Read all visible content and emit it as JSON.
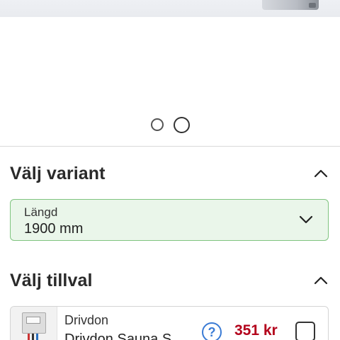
{
  "gallery": {
    "dots": [
      "",
      ""
    ],
    "active_index": 1
  },
  "variant": {
    "title": "Välj variant",
    "select": {
      "label": "Längd",
      "value": "1900 mm"
    }
  },
  "tillval": {
    "title": "Välj tillval",
    "items": [
      {
        "category": "Drivdon",
        "name": "Drivdon Sauna S",
        "help": "?",
        "price": "351 kr",
        "checked": false
      }
    ]
  },
  "colors": {
    "price": "#b3001b",
    "select_bg": "#eaf6ea",
    "select_border": "#7fc47f",
    "help": "#3a7bd5"
  },
  "icons": [
    "chevron-up-icon",
    "chevron-down-icon",
    "help-icon",
    "checkbox-icon"
  ]
}
